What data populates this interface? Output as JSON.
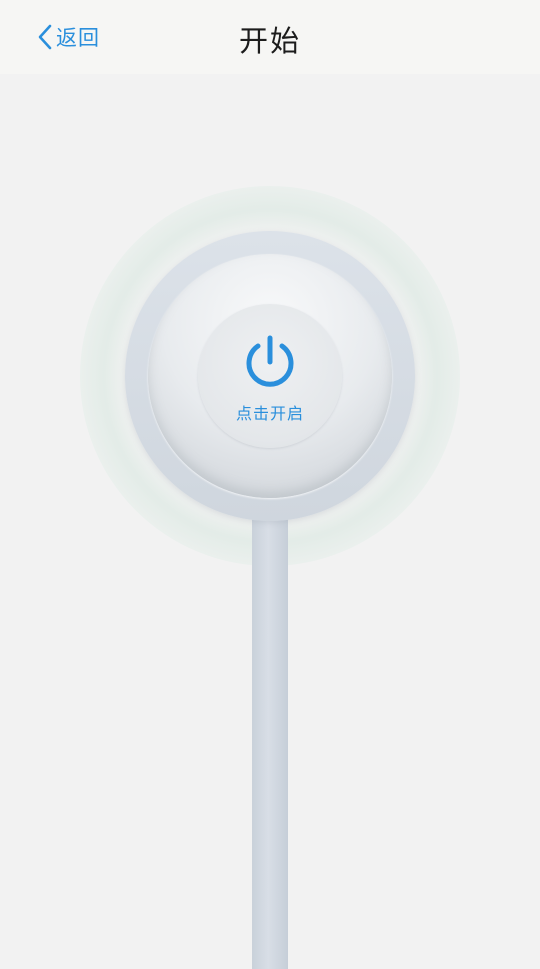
{
  "navbar": {
    "back_label": "返回",
    "title": "开始"
  },
  "main": {
    "power_button_label": "点击开启"
  },
  "colors": {
    "accent": "#2a8fdc",
    "background": "#f2f2f2",
    "navbar_background": "#f6f6f4",
    "title_text": "#1c1c1c"
  },
  "icons": {
    "back": "chevron-left-icon",
    "power": "power-icon"
  }
}
